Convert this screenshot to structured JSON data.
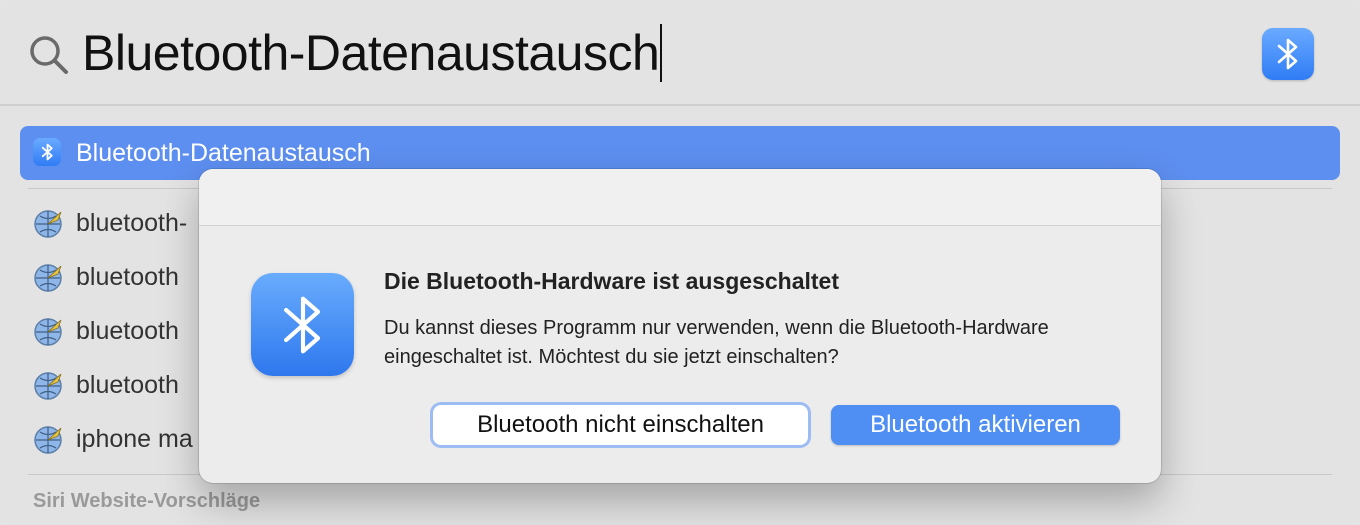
{
  "search": {
    "query": "Bluetooth-Datenaustausch"
  },
  "top_hit": {
    "label": "Bluetooth-Datenaustausch",
    "icon": "bluetooth-icon"
  },
  "suggestions": [
    {
      "label": "bluetooth-",
      "icon": "safari-globe-icon"
    },
    {
      "label": "bluetooth",
      "icon": "safari-globe-icon"
    },
    {
      "label": "bluetooth",
      "icon": "safari-globe-icon"
    },
    {
      "label": "bluetooth",
      "icon": "safari-globe-icon"
    },
    {
      "label": "iphone ma",
      "icon": "safari-globe-icon"
    }
  ],
  "section": {
    "siri_suggestions": "Siri Website-Vorschläge"
  },
  "dialog": {
    "title": "Die Bluetooth-Hardware ist ausgeschaltet",
    "message": "Du kannst dieses Programm nur verwenden, wenn die Bluetooth-Hardware eingeschaltet ist. Möchtest du sie jetzt einschalten?",
    "cancel_label": "Bluetooth nicht einschalten",
    "confirm_label": "Bluetooth aktivieren"
  },
  "colors": {
    "accent": "#4f8ff3",
    "selection": "#5d8ff0",
    "background": "#e3e3e3"
  }
}
